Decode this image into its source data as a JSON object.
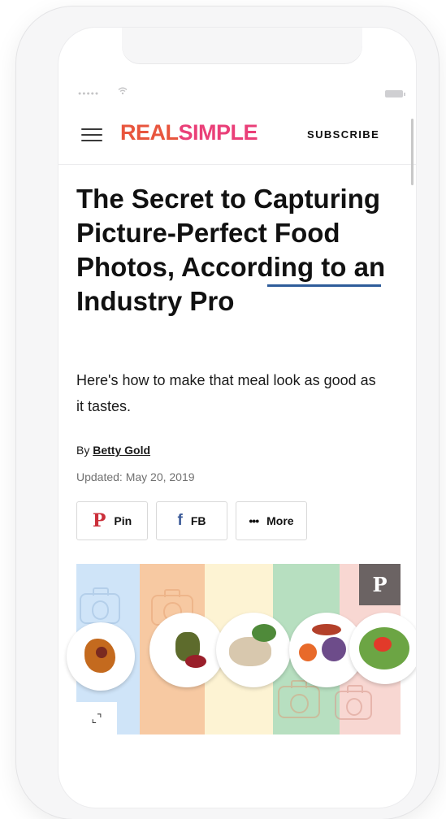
{
  "header": {
    "logo_part1": "REAL",
    "logo_part2": "SIMPLE",
    "subscribe_label": "SUBSCRIBE"
  },
  "article": {
    "title": "The Secret to Capturing Picture-Perfect Food Photos, According to an Industry Pro",
    "dek": "Here's how to make that meal look as good as it tastes.",
    "byline_prefix": "By",
    "author": "Betty Gold",
    "updated": "Updated: May 20, 2019"
  },
  "share": {
    "pin_label": "Pin",
    "fb_label": "FB",
    "more_label": "More"
  },
  "icons": {
    "pin": "pinterest-icon",
    "fb": "facebook-icon",
    "more": "more-dots-icon",
    "menu": "hamburger-menu-icon",
    "expand": "expand-icon"
  },
  "colors": {
    "logo_real": "#e8553d",
    "logo_simple": "#ea3f78",
    "highlight_underline": "#2e5c9a",
    "pinterest": "#cb2f3a",
    "facebook": "#3b5a98",
    "stripes": [
      "#cfe4f8",
      "#f7c9a2",
      "#fdf3d3",
      "#b7dfc0",
      "#f8d7d2"
    ]
  }
}
